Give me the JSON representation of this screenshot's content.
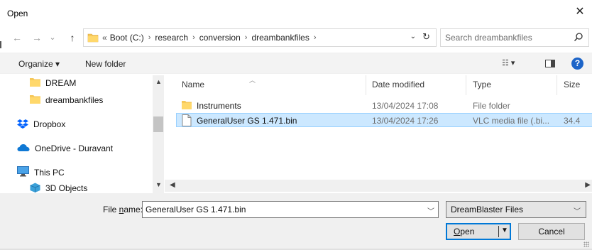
{
  "window": {
    "title": "Open",
    "close_glyph": "✕"
  },
  "nav": {
    "back_glyph": "←",
    "forward_glyph": "→",
    "recent_glyph": "⌄",
    "up_glyph": "↑"
  },
  "address": {
    "overflow_glyph": "«",
    "separator": "›",
    "breadcrumbs": [
      "Boot (C:)",
      "research",
      "conversion",
      "dreambankfiles"
    ],
    "dropdown_glyph": "⌄",
    "refresh_glyph": "↻"
  },
  "search": {
    "placeholder": "Search dreambankfiles",
    "icon": "search-icon"
  },
  "toolbar": {
    "organize_label": "Organize ▾",
    "new_folder_label": "New folder",
    "view_glyph": "☷ ▾",
    "help_glyph": "?"
  },
  "sidebar": {
    "items": [
      {
        "label": "DREAM",
        "icon": "folder-icon"
      },
      {
        "label": "dreambankfiles",
        "icon": "folder-icon"
      },
      {
        "label": "Dropbox",
        "icon": "dropbox-icon"
      },
      {
        "label": "OneDrive - Duravant",
        "icon": "onedrive-icon"
      },
      {
        "label": "This PC",
        "icon": "computer-icon"
      },
      {
        "label": "3D Objects",
        "icon": "3d-objects-icon"
      }
    ]
  },
  "columns": {
    "name": "Name",
    "date_modified": "Date modified",
    "type": "Type",
    "size": "Size"
  },
  "files": [
    {
      "name": "Instruments",
      "date": "13/04/2024 17:08",
      "type": "File folder",
      "size": "",
      "icon": "folder-icon",
      "selected": false
    },
    {
      "name": "GeneralUser GS 1.471.bin",
      "date": "13/04/2024 17:26",
      "type": "VLC media file (.bi...",
      "size": "34.4",
      "icon": "file-icon",
      "selected": true
    }
  ],
  "filename": {
    "label_prefix": "File ",
    "label_underlined": "n",
    "label_suffix": "ame:",
    "value": "GeneralUser GS 1.471.bin"
  },
  "filetype": {
    "selected": "DreamBlaster Files"
  },
  "buttons": {
    "open_underlined": "O",
    "open_rest": "pen",
    "cancel": "Cancel"
  },
  "colors": {
    "selection_bg": "#cce8ff",
    "selection_border": "#99d1ff",
    "accent": "#0078d7",
    "folder": "#f6c85a"
  }
}
